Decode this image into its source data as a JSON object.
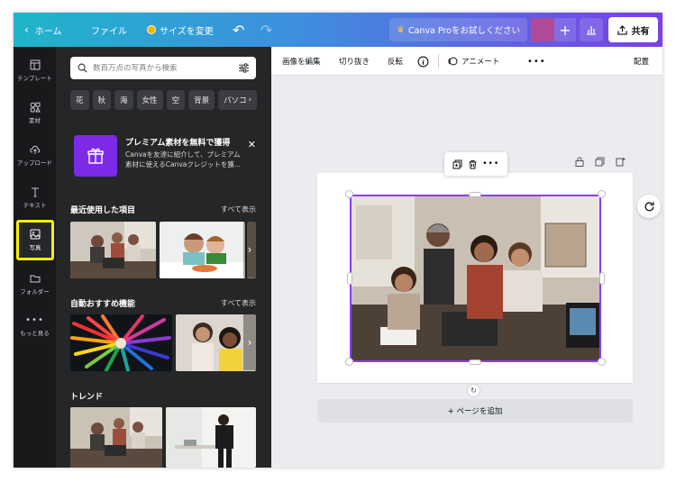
{
  "topbar": {
    "home_label": "ホーム",
    "file_label": "ファイル",
    "resize_label": "サイズを変更",
    "pro_label": "Canva Proをお試しください",
    "share_label": "共有"
  },
  "rail": {
    "items": [
      {
        "label": "テンプレート",
        "icon": "layout-icon"
      },
      {
        "label": "素材",
        "icon": "elements-icon"
      },
      {
        "label": "アップロード",
        "icon": "cloud-upload-icon"
      },
      {
        "label": "テキスト",
        "icon": "text-icon"
      },
      {
        "label": "写真",
        "icon": "image-icon"
      },
      {
        "label": "フォルダー",
        "icon": "folder-icon"
      },
      {
        "label": "もっと見る",
        "icon": "more-icon"
      }
    ]
  },
  "panel": {
    "search_placeholder": "数百万点の写真から検索",
    "chips": [
      "花",
      "秋",
      "海",
      "女性",
      "空",
      "背景",
      "パソコ"
    ],
    "promo": {
      "title": "プレミアム素材を無料で獲得",
      "body": "Canvaを友達に紹介して、プレミアム素材に使えるCanvaクレジットを獲..."
    },
    "recent": {
      "title": "最近使用した項目",
      "see_all": "すべて表示"
    },
    "auto": {
      "title": "自動おすすめ機能",
      "see_all": "すべて表示"
    },
    "trend": {
      "title": "トレンド"
    }
  },
  "editor": {
    "ctx": {
      "edit_image": "画像を編集",
      "crop": "切り抜き",
      "flip": "反転",
      "animate": "アニメート",
      "position": "配置"
    },
    "add_page": "+ ページを追加"
  },
  "colors": {
    "accent_purple": "#8b3dff",
    "rail_bg": "#18191b",
    "panel_bg": "#252627",
    "highlight": "#ffef00"
  }
}
